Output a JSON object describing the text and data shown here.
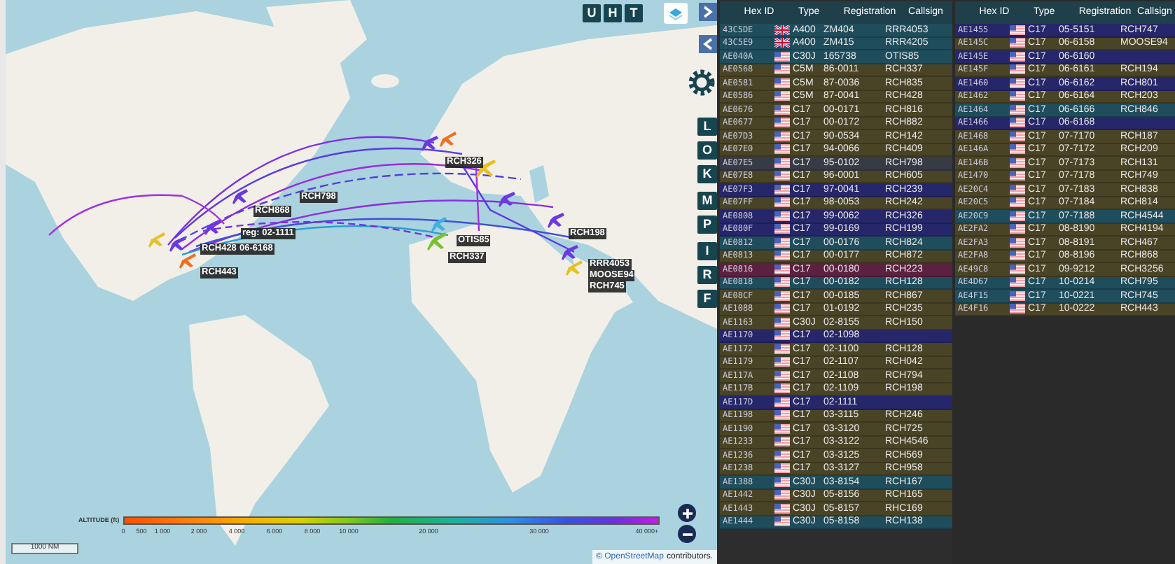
{
  "map": {
    "top_buttons": [
      "U",
      "H",
      "T"
    ],
    "side_buttons": [
      "L",
      "O",
      "K",
      "M",
      "P",
      "I",
      "R",
      "F"
    ],
    "labels": [
      {
        "text": "RCH326"
      },
      {
        "text": "RCH798"
      },
      {
        "text": "RCH868"
      },
      {
        "text": "reg: 02-1111"
      },
      {
        "text": "RCH428"
      },
      {
        "text": "06-6168"
      },
      {
        "text": "RCH443"
      },
      {
        "text": "OTIS85"
      },
      {
        "text": "RCH337"
      },
      {
        "text": "RCH198"
      },
      {
        "text": "RRR4053"
      },
      {
        "text": "MOOSE94"
      },
      {
        "text": "RCH745"
      }
    ],
    "legend": {
      "title": "ALTITUDE (ft)",
      "ticks": [
        "0",
        "500",
        "1 000",
        "2 000",
        "4 000",
        "6 000",
        "8 000",
        "10 000",
        "20 000",
        "30 000",
        "40 000+"
      ]
    },
    "scale": "1000 NM",
    "attribution_link": "© OpenStreetMap",
    "attribution_text": "contributors."
  },
  "tables": [
    {
      "columns": [
        "Hex ID",
        "Type",
        "Registration",
        "Callsign"
      ],
      "rows": [
        {
          "hex": "43C5DE",
          "kind": "uk",
          "type": "A400",
          "reg": "ZM404",
          "callsign": "RRR4053",
          "color": "#1f4d5c"
        },
        {
          "hex": "43C5E9",
          "kind": "uk",
          "type": "A400",
          "reg": "ZM415",
          "callsign": "RRR4205",
          "color": "#1f4d5c"
        },
        {
          "hex": "AE040A",
          "kind": "us",
          "type": "C30J",
          "reg": "165738",
          "callsign": "OTIS85",
          "color": "#1f4d5c"
        },
        {
          "hex": "AE0568",
          "kind": "us",
          "type": "C5M",
          "reg": "86-0011",
          "callsign": "RCH337",
          "color": "#4a4426"
        },
        {
          "hex": "AE0581",
          "kind": "us",
          "type": "C5M",
          "reg": "87-0036",
          "callsign": "RCH835",
          "color": "#4a4426"
        },
        {
          "hex": "AE0586",
          "kind": "us",
          "type": "C5M",
          "reg": "87-0041",
          "callsign": "RCH428",
          "color": "#4a4426"
        },
        {
          "hex": "AE0676",
          "kind": "us",
          "type": "C17",
          "reg": "00-0171",
          "callsign": "RCH816",
          "color": "#4a4426"
        },
        {
          "hex": "AE0677",
          "kind": "us",
          "type": "C17",
          "reg": "00-0172",
          "callsign": "RCH882",
          "color": "#4a4426"
        },
        {
          "hex": "AE07D3",
          "kind": "us",
          "type": "C17",
          "reg": "90-0534",
          "callsign": "RCH142",
          "color": "#4a4426"
        },
        {
          "hex": "AE07E0",
          "kind": "us",
          "type": "C17",
          "reg": "94-0066",
          "callsign": "RCH409",
          "color": "#4a4426"
        },
        {
          "hex": "AE07E5",
          "kind": "us",
          "type": "C17",
          "reg": "95-0102",
          "callsign": "RCH798",
          "color": "#363b46"
        },
        {
          "hex": "AE07E8",
          "kind": "us",
          "type": "C17",
          "reg": "96-0001",
          "callsign": "RCH605",
          "color": "#4a4426"
        },
        {
          "hex": "AE07F3",
          "kind": "us",
          "type": "C17",
          "reg": "97-0041",
          "callsign": "RCH239",
          "color": "#26266a"
        },
        {
          "hex": "AE07FF",
          "kind": "us",
          "type": "C17",
          "reg": "98-0053",
          "callsign": "RCH242",
          "color": "#4a4426"
        },
        {
          "hex": "AE0808",
          "kind": "us",
          "type": "C17",
          "reg": "99-0062",
          "callsign": "RCH326",
          "color": "#26266a"
        },
        {
          "hex": "AE080F",
          "kind": "us",
          "type": "C17",
          "reg": "99-0169",
          "callsign": "RCH199",
          "color": "#26266a"
        },
        {
          "hex": "AE0812",
          "kind": "us",
          "type": "C17",
          "reg": "00-0176",
          "callsign": "RCH824",
          "color": "#1f4d5c"
        },
        {
          "hex": "AE0813",
          "kind": "us",
          "type": "C17",
          "reg": "00-0177",
          "callsign": "RCH872",
          "color": "#4a4426"
        },
        {
          "hex": "AE0816",
          "kind": "us",
          "type": "C17",
          "reg": "00-0180",
          "callsign": "RCH223",
          "color": "#5c2040"
        },
        {
          "hex": "AE0818",
          "kind": "us",
          "type": "C17",
          "reg": "00-0182",
          "callsign": "RCH128",
          "color": "#1f4d5c"
        },
        {
          "hex": "AE08CF",
          "kind": "us",
          "type": "C17",
          "reg": "00-0185",
          "callsign": "RCH867",
          "color": "#4a4426"
        },
        {
          "hex": "AE1088",
          "kind": "us",
          "type": "C17",
          "reg": "01-0192",
          "callsign": "RCH235",
          "color": "#4a4426"
        },
        {
          "hex": "AE1163",
          "kind": "us",
          "type": "C30J",
          "reg": "02-8155",
          "callsign": "RCH150",
          "color": "#4a4426"
        },
        {
          "hex": "AE1170",
          "kind": "us",
          "type": "C17",
          "reg": "02-1098",
          "color": "#26266a"
        },
        {
          "hex": "AE1172",
          "kind": "us",
          "type": "C17",
          "reg": "02-1100",
          "callsign": "RCH128",
          "color": "#4a4426"
        },
        {
          "hex": "AE1179",
          "kind": "us",
          "type": "C17",
          "reg": "02-1107",
          "callsign": "RCH042",
          "color": "#4a4426"
        },
        {
          "hex": "AE117A",
          "kind": "us",
          "type": "C17",
          "reg": "02-1108",
          "callsign": "RCH794",
          "color": "#4a4426"
        },
        {
          "hex": "AE117B",
          "kind": "us",
          "type": "C17",
          "reg": "02-1109",
          "callsign": "RCH198",
          "color": "#4a4426"
        },
        {
          "hex": "AE117D",
          "kind": "us",
          "type": "C17",
          "reg": "02-1111",
          "color": "#26266a"
        },
        {
          "hex": "AE1198",
          "kind": "us",
          "type": "C17",
          "reg": "03-3115",
          "callsign": "RCH246",
          "color": "#4a4426"
        },
        {
          "hex": "AE1190",
          "kind": "us",
          "type": "C17",
          "reg": "03-3120",
          "callsign": "RCH725",
          "color": "#4a4426"
        },
        {
          "hex": "AE1233",
          "kind": "us",
          "type": "C17",
          "reg": "03-3122",
          "callsign": "RCH4546",
          "color": "#4a4426"
        },
        {
          "hex": "AE1236",
          "kind": "us",
          "type": "C17",
          "reg": "03-3125",
          "callsign": "RCH569",
          "color": "#4a4426"
        },
        {
          "hex": "AE1238",
          "kind": "us",
          "type": "C17",
          "reg": "03-3127",
          "callsign": "RCH958",
          "color": "#4a4426"
        },
        {
          "hex": "AE1388",
          "kind": "us",
          "type": "C30J",
          "reg": "03-8154",
          "callsign": "RCH167",
          "color": "#1f4d5c"
        },
        {
          "hex": "AE1442",
          "kind": "us",
          "type": "C30J",
          "reg": "05-8156",
          "callsign": "RCH165",
          "color": "#4a4426"
        },
        {
          "hex": "AE1443",
          "kind": "us",
          "type": "C30J",
          "reg": "05-8157",
          "callsign": "RHC169",
          "color": "#4a4426"
        },
        {
          "hex": "AE1444",
          "kind": "us",
          "type": "C30J",
          "reg": "05-8158",
          "callsign": "RCH138",
          "color": "#1f4d5c"
        }
      ]
    },
    {
      "columns": [
        "Hex ID",
        "Type",
        "Registration",
        "Callsign"
      ],
      "rows": [
        {
          "hex": "AE1455",
          "kind": "us",
          "type": "C17",
          "reg": "05-5151",
          "callsign": "RCH747",
          "color": "#26266a"
        },
        {
          "hex": "AE145C",
          "kind": "us",
          "type": "C17",
          "reg": "06-6158",
          "callsign": "MOOSE94",
          "color": "#4a4426"
        },
        {
          "hex": "AE145E",
          "kind": "us",
          "type": "C17",
          "reg": "06-6160",
          "color": "#26266a"
        },
        {
          "hex": "AE145F",
          "kind": "us",
          "type": "C17",
          "reg": "06-6161",
          "callsign": "RCH194",
          "color": "#4a4426"
        },
        {
          "hex": "AE1460",
          "kind": "us",
          "type": "C17",
          "reg": "06-6162",
          "callsign": "RCH801",
          "color": "#26266a"
        },
        {
          "hex": "AE1462",
          "kind": "us",
          "type": "C17",
          "reg": "06-6164",
          "callsign": "RCH203",
          "color": "#4a4426"
        },
        {
          "hex": "AE1464",
          "kind": "us",
          "type": "C17",
          "reg": "06-6166",
          "callsign": "RCH846",
          "color": "#1f4d5c"
        },
        {
          "hex": "AE1466",
          "kind": "us",
          "type": "C17",
          "reg": "06-6168",
          "color": "#26266a"
        },
        {
          "hex": "AE1468",
          "kind": "us",
          "type": "C17",
          "reg": "07-7170",
          "callsign": "RCH187",
          "color": "#4a4426"
        },
        {
          "hex": "AE146A",
          "kind": "us",
          "type": "C17",
          "reg": "07-7172",
          "callsign": "RCH209",
          "color": "#4a4426"
        },
        {
          "hex": "AE146B",
          "kind": "us",
          "type": "C17",
          "reg": "07-7173",
          "callsign": "RCH131",
          "color": "#4a4426"
        },
        {
          "hex": "AE1470",
          "kind": "us",
          "type": "C17",
          "reg": "07-7178",
          "callsign": "RCH749",
          "color": "#4a4426"
        },
        {
          "hex": "AE20C4",
          "kind": "us",
          "type": "C17",
          "reg": "07-7183",
          "callsign": "RCH838",
          "color": "#4a4426"
        },
        {
          "hex": "AE20C5",
          "kind": "us",
          "type": "C17",
          "reg": "07-7184",
          "callsign": "RCH814",
          "color": "#4a4426"
        },
        {
          "hex": "AE20C9",
          "kind": "us",
          "type": "C17",
          "reg": "07-7188",
          "callsign": "RCH4544",
          "color": "#1f4d5c"
        },
        {
          "hex": "AE2FA2",
          "kind": "us",
          "type": "C17",
          "reg": "08-8190",
          "callsign": "RCH4194",
          "color": "#4a4426"
        },
        {
          "hex": "AE2FA3",
          "kind": "us",
          "type": "C17",
          "reg": "08-8191",
          "callsign": "RCH467",
          "color": "#4a4426"
        },
        {
          "hex": "AE2FA8",
          "kind": "us",
          "type": "C17",
          "reg": "08-8196",
          "callsign": "RCH868",
          "color": "#4a4426"
        },
        {
          "hex": "AE49C8",
          "kind": "us",
          "type": "C17",
          "reg": "09-9212",
          "callsign": "RCH3256",
          "color": "#4a4426"
        },
        {
          "hex": "AE4D67",
          "kind": "us",
          "type": "C17",
          "reg": "10-0214",
          "callsign": "RCH795",
          "color": "#1f4d5c"
        },
        {
          "hex": "AE4F15",
          "kind": "us",
          "type": "C17",
          "reg": "10-0221",
          "callsign": "RCH745",
          "color": "#1f4d5c"
        },
        {
          "hex": "AE4F16",
          "kind": "us",
          "type": "C17",
          "reg": "10-0222",
          "callsign": "RCH443",
          "color": "#4a4426"
        }
      ]
    }
  ]
}
